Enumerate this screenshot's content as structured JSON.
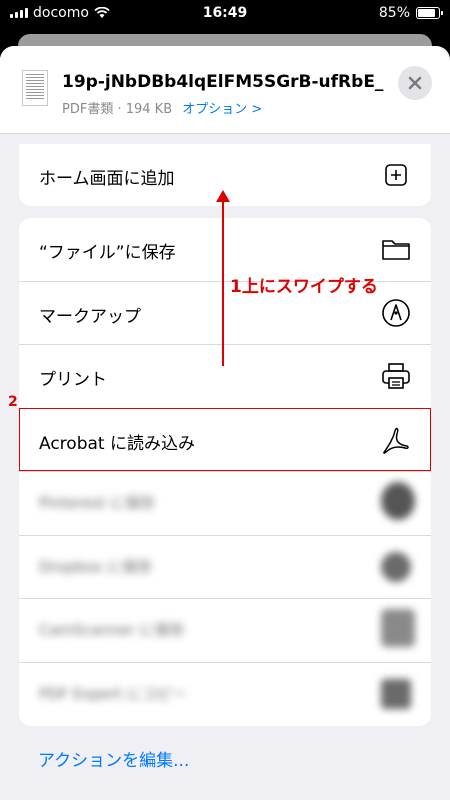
{
  "status_bar": {
    "carrier": "docomo",
    "time": "16:49",
    "battery": "85%",
    "battery_level": 0.85
  },
  "sheet": {
    "file_name": "19p-jNbDBb4lqElFM5SGrB-ufRbE_...",
    "file_meta": "PDF書類 · 194 KB",
    "options_link": "オプション >",
    "close_icon": "close-icon"
  },
  "actions_top": [
    {
      "label": "ホーム画面に追加",
      "icon": "add-square-icon"
    }
  ],
  "actions": [
    {
      "label": "“ファイル”に保存",
      "icon": "folder-icon"
    },
    {
      "label": "マークアップ",
      "icon": "markup-pen-icon"
    },
    {
      "label": "プリント",
      "icon": "printer-icon"
    },
    {
      "label": "Acrobat に読み込み",
      "icon": "acrobat-icon"
    },
    {
      "label": "Pinterest に保存",
      "icon": "pinterest-icon",
      "blurred": true
    },
    {
      "label": "Dropbox に保存",
      "icon": "dropbox-icon",
      "blurred": true
    },
    {
      "label": "CamScanner に保存",
      "icon": "camscanner-icon",
      "blurred": true
    },
    {
      "label": "PDF Expert にコピー",
      "icon": "pdf-expert-icon",
      "blurred": true
    }
  ],
  "edit_actions": "アクションを編集...",
  "annotations": {
    "step1": "1上にスワイプする",
    "step2": "2",
    "color": "#e00000"
  },
  "colors": {
    "accent": "#007aff",
    "sheet_bg": "#efeff4"
  }
}
